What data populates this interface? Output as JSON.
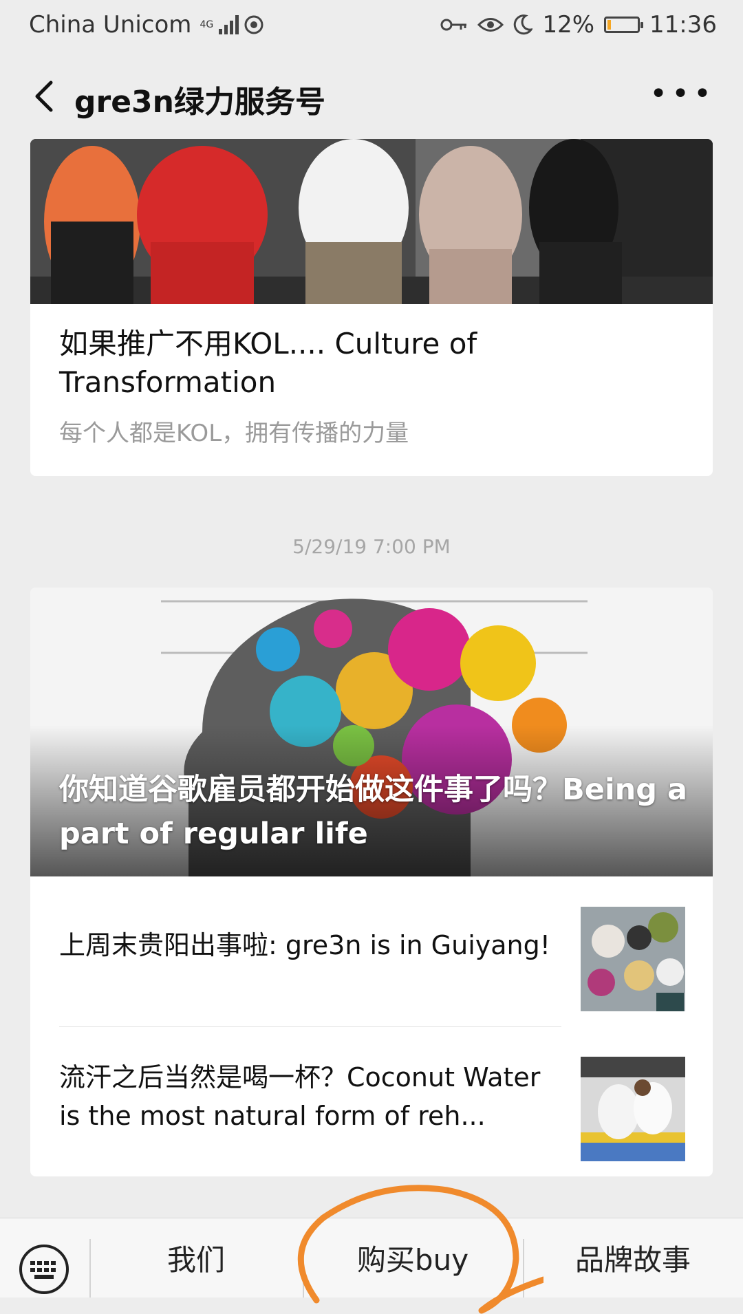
{
  "status_bar": {
    "carrier": "China Unicom",
    "network": "4G",
    "battery": "12%",
    "battery_level": 0.12,
    "time": "11:36",
    "icons": [
      "signal-icon",
      "nfc-icon",
      "key-icon",
      "eye-icon",
      "moon-icon",
      "battery-icon"
    ]
  },
  "nav": {
    "title": "gre3n绿力服务号",
    "back_icon": "chevron-left-icon",
    "more_icon": "more-dots-icon"
  },
  "article1": {
    "title": "如果推广不用KOL.... Culture of Transformation",
    "subtitle": "每个人都是KOL，拥有传播的力量"
  },
  "timestamp": "5/29/19 7:00 PM",
  "article2": {
    "hero_title": "你知道谷歌雇员都开始做这件事了吗？Being a part of regular life",
    "items": [
      {
        "title": "上周末贵阳出事啦: gre3n is in Guiyang!"
      },
      {
        "title": "流汗之后当然是喝一杯？Coconut Water is the most natural form of reh..."
      }
    ]
  },
  "bottom_menu": {
    "keyboard_icon": "keyboard-icon",
    "items": [
      "我们",
      "购买buy",
      "品牌故事"
    ],
    "highlight_color": "#f08a2c"
  }
}
